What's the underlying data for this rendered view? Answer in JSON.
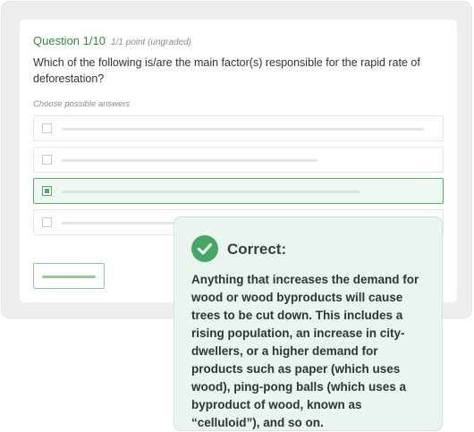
{
  "question": {
    "number_label": "Question 1/10",
    "points_label": "1/1 point (ungraded)",
    "text": "Which of the following is/are the main factor(s) responsible for the rapid rate of deforestation?",
    "choose_label": "Choose possible answers"
  },
  "answers": [
    {
      "selected": false
    },
    {
      "selected": false
    },
    {
      "selected": true
    },
    {
      "selected": false
    }
  ],
  "feedback": {
    "title": "Correct:",
    "text": "Anything that increases the demand for wood or wood byproducts will cause trees to be cut down. This includes a rising population, an increase in city-dwellers, or a higher demand for products such as paper (which uses wood), ping-pong balls (which uses a byproduct of wood, known as “celluloid”), and so on.",
    "icon": "check-circle-icon"
  },
  "colors": {
    "accent_green": "#2e8b3e",
    "feedback_bg": "#e9f5ee",
    "check_green": "#44a865"
  }
}
